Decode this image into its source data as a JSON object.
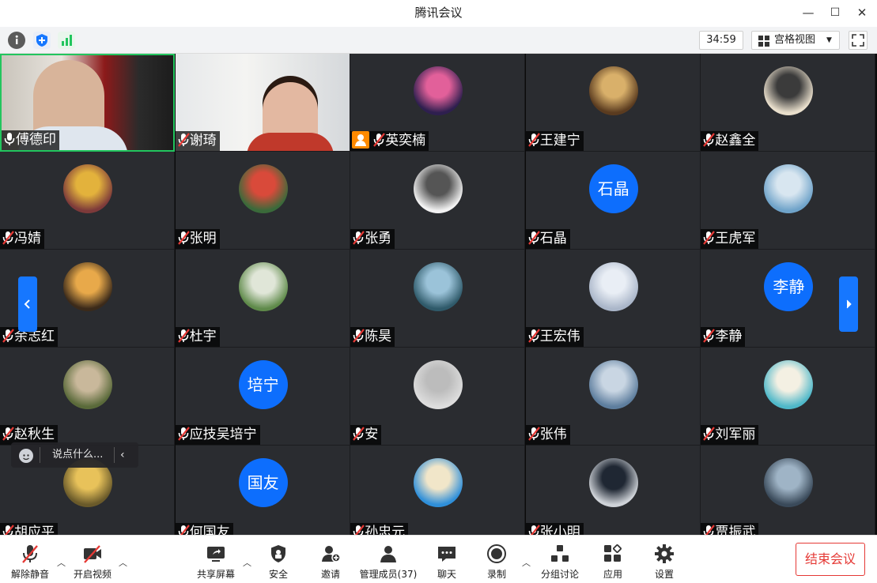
{
  "window": {
    "title": "腾讯会议",
    "minimize": "—",
    "maximize": "☐",
    "close": "✕"
  },
  "infobar": {
    "timer": "34:59",
    "view_label": "宫格视图"
  },
  "participants": [
    {
      "name": "傅德印",
      "muted": false,
      "video": true,
      "active": true
    },
    {
      "name": "谢琦",
      "muted": true,
      "video": true
    },
    {
      "name": "英奕楠",
      "muted": true,
      "host": true
    },
    {
      "name": "王建宁",
      "muted": true
    },
    {
      "name": "赵鑫全",
      "muted": true
    },
    {
      "name": "冯婧",
      "muted": true
    },
    {
      "name": "张明",
      "muted": true
    },
    {
      "name": "张勇",
      "muted": true
    },
    {
      "name": "石晶",
      "muted": true,
      "avatar_text": "石晶"
    },
    {
      "name": "王虎军",
      "muted": true
    },
    {
      "name": "余志红",
      "muted": true
    },
    {
      "name": "杜宇",
      "muted": true
    },
    {
      "name": "陈昊",
      "muted": true
    },
    {
      "name": "王宏伟",
      "muted": true
    },
    {
      "name": "李静",
      "muted": true,
      "avatar_text": "李静"
    },
    {
      "name": "赵秋生",
      "muted": true
    },
    {
      "name": "应技吴培宁",
      "muted": true,
      "avatar_text": "培宁"
    },
    {
      "name": "安",
      "muted": true
    },
    {
      "name": "张伟",
      "muted": true
    },
    {
      "name": "刘军丽",
      "muted": true
    },
    {
      "name": "胡应平",
      "muted": true
    },
    {
      "name": "何国友",
      "muted": true,
      "avatar_text": "国友"
    },
    {
      "name": "孙忠元",
      "muted": true
    },
    {
      "name": "张小明",
      "muted": true
    },
    {
      "name": "贾振武",
      "muted": true
    }
  ],
  "chat": {
    "placeholder": "说点什么..."
  },
  "toolbar": {
    "unmute": "解除静音",
    "start_video": "开启视频",
    "share_screen": "共享屏幕",
    "security": "安全",
    "invite": "邀请",
    "manage_members": "管理成员(37)",
    "chat": "聊天",
    "record": "录制",
    "breakout": "分组讨论",
    "apps": "应用",
    "settings": "设置",
    "end_meeting": "结束会议"
  },
  "colors": {
    "accent": "#1677ff",
    "danger": "#e53935",
    "active_speaker": "#22c55e",
    "tile_bg": "#2a2c30"
  }
}
